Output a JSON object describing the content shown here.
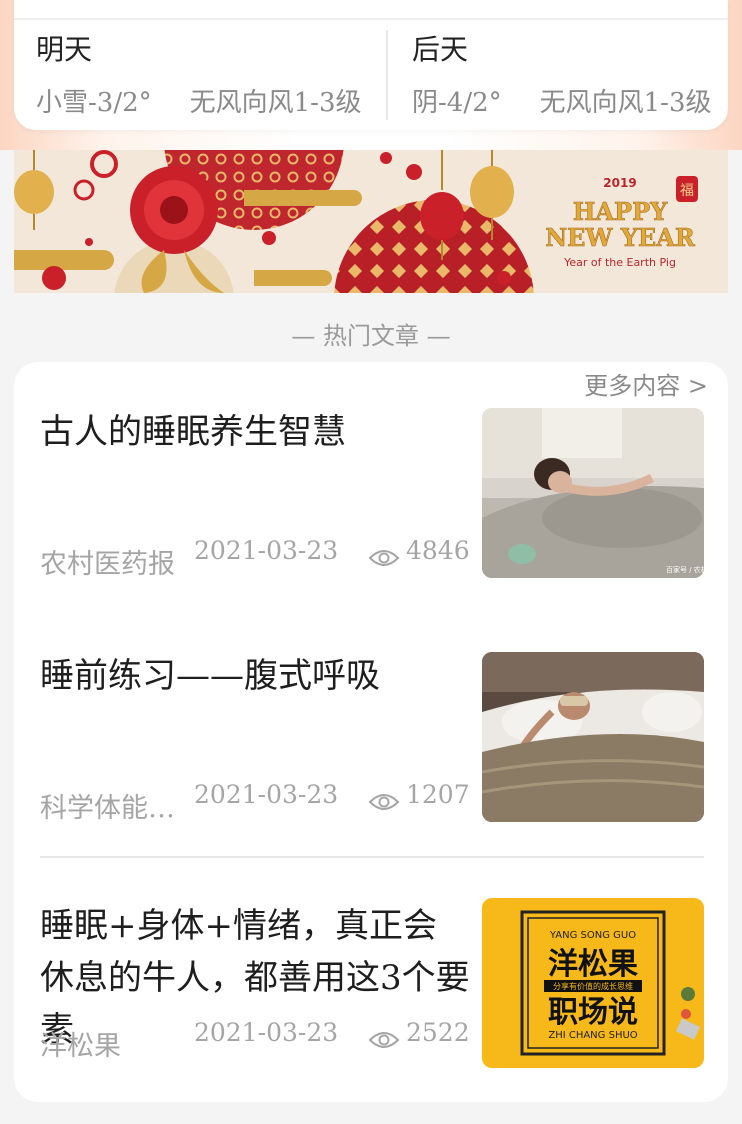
{
  "weather": {
    "tomorrow": {
      "day": "明天",
      "cond": "小雪-3/2°",
      "wind": "无风向风1-3级"
    },
    "after": {
      "day": "后天",
      "cond": "阴-4/2°",
      "wind": "无风向风1-3级"
    }
  },
  "banner": {
    "year": "2019",
    "line1": "HAPPY",
    "line2": "NEW YEAR",
    "tagline": "Year of the Earth Pig",
    "fu": "福"
  },
  "section": {
    "title": "— 热门文章 —",
    "more": "更多内容 >"
  },
  "articles": [
    {
      "title": "古人的睡眠养生智慧",
      "source": "农村医药报",
      "date": "2021-03-23",
      "views": "4846",
      "watermark": "百家号 / 农村"
    },
    {
      "title": "睡前练习——腹式呼吸",
      "source": "科学体能…",
      "date": "2021-03-23",
      "views": "1207"
    },
    {
      "title": "睡眠+身体+情绪，真正会休息的牛人，都善用这3个要素",
      "source": "洋松果",
      "date": "2021-03-23",
      "views": "2522",
      "thumb": {
        "top": "YANG SONG GUO",
        "main1": "洋松果",
        "sub": "分享有价值的成长思维",
        "main2": "职场说",
        "bottom": "ZHI CHANG SHUO"
      }
    }
  ]
}
